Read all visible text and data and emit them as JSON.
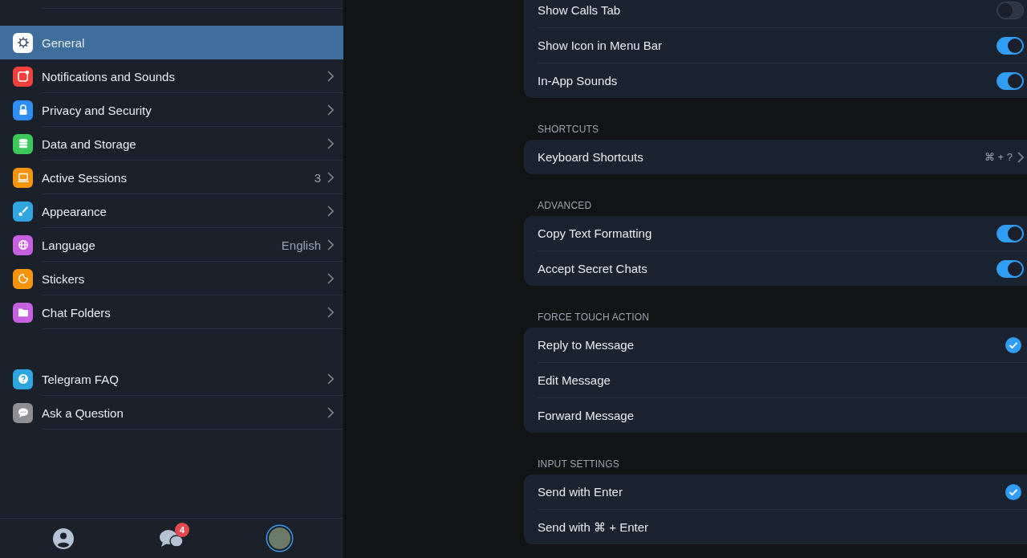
{
  "sidebar": {
    "items": [
      {
        "label": "General",
        "color": "#ffffff",
        "selected": true
      },
      {
        "label": "Notifications and Sounds",
        "color": "#f0413a",
        "selected": false
      },
      {
        "label": "Privacy and Security",
        "color": "#2f8ef4",
        "selected": false
      },
      {
        "label": "Data and Storage",
        "color": "#3ec85a",
        "selected": false
      },
      {
        "label": "Active Sessions",
        "color": "#f7940c",
        "value": "3",
        "selected": false
      },
      {
        "label": "Appearance",
        "color": "#2fa6e0",
        "selected": false
      },
      {
        "label": "Language",
        "color": "#c760e0",
        "value": "English",
        "selected": false
      },
      {
        "label": "Stickers",
        "color": "#f7940c",
        "selected": false
      },
      {
        "label": "Chat Folders",
        "color": "#c760e0",
        "selected": false
      }
    ],
    "help_items": [
      {
        "label": "Telegram FAQ",
        "color": "#2fa6e0",
        "selected": false
      },
      {
        "label": "Ask a Question",
        "color": "#8e8e93",
        "selected": false
      }
    ]
  },
  "bottom_bar": {
    "tabs": [
      {
        "kind": "contacts",
        "selected": false
      },
      {
        "kind": "chats",
        "badge": "4",
        "selected": false
      },
      {
        "kind": "profile",
        "selected": true
      }
    ]
  },
  "sections": [
    {
      "rows": [
        {
          "kind": "toggle",
          "label": "Show Calls Tab",
          "on": false
        },
        {
          "kind": "toggle",
          "label": "Show Icon in Menu Bar",
          "on": true
        },
        {
          "kind": "toggle",
          "label": "In-App Sounds",
          "on": true
        }
      ]
    },
    {
      "header": "SHORTCUTS",
      "rows": [
        {
          "kind": "link",
          "label": "Keyboard Shortcuts",
          "value": "⌘ + ?"
        }
      ]
    },
    {
      "header": "ADVANCED",
      "rows": [
        {
          "kind": "toggle",
          "label": "Copy Text Formatting",
          "on": true
        },
        {
          "kind": "toggle",
          "label": "Accept Secret Chats",
          "on": true
        }
      ]
    },
    {
      "header": "FORCE TOUCH ACTION",
      "rows": [
        {
          "kind": "check",
          "label": "Reply to Message",
          "selected": true
        },
        {
          "kind": "check",
          "label": "Edit Message",
          "selected": false
        },
        {
          "kind": "check",
          "label": "Forward Message",
          "selected": false
        }
      ]
    },
    {
      "header": "INPUT SETTINGS",
      "rows": [
        {
          "kind": "check",
          "label": "Send with Enter",
          "selected": true
        },
        {
          "kind": "check",
          "label": "Send with ⌘ + Enter",
          "selected": false
        }
      ]
    }
  ]
}
